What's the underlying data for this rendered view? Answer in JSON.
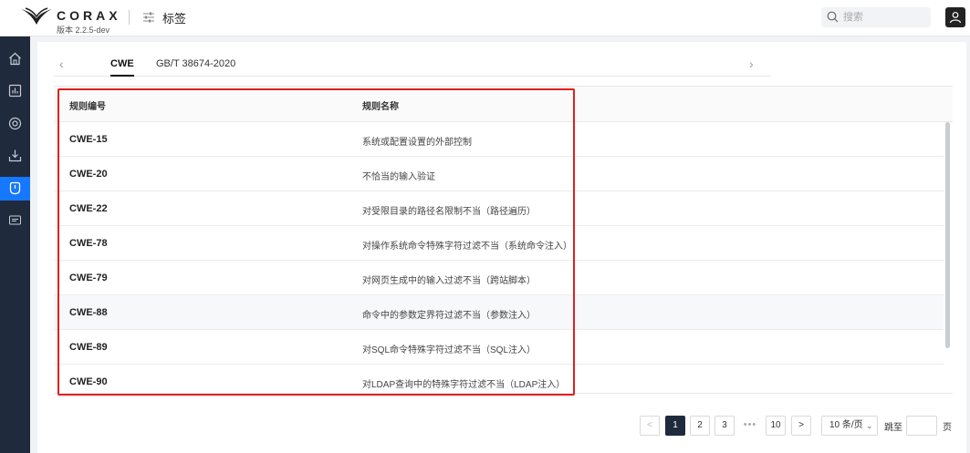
{
  "header": {
    "brand": "CORAX",
    "version": "版本 2.2.5-dev",
    "page_title": "标签",
    "search_placeholder": "搜索"
  },
  "sidebar": {
    "items": [
      {
        "name": "home-icon"
      },
      {
        "name": "chart-icon"
      },
      {
        "name": "target-icon"
      },
      {
        "name": "download-icon"
      },
      {
        "name": "tag-icon",
        "active": true
      },
      {
        "name": "help-icon"
      }
    ]
  },
  "tabs": [
    {
      "label": "CWE",
      "active": true
    },
    {
      "label": "GB/T 38674-2020",
      "active": false
    }
  ],
  "table": {
    "headers": [
      "规则编号",
      "规则名称"
    ],
    "rows": [
      {
        "id": "CWE-15",
        "name": "系统或配置设置的外部控制"
      },
      {
        "id": "CWE-20",
        "name": "不恰当的输入验证"
      },
      {
        "id": "CWE-22",
        "name": "对受限目录的路径名限制不当（路径遍历）"
      },
      {
        "id": "CWE-78",
        "name": "对操作系统命令特殊字符过滤不当（系统命令注入）"
      },
      {
        "id": "CWE-79",
        "name": "对网页生成中的输入过滤不当（跨站脚本）"
      },
      {
        "id": "CWE-88",
        "name": "命令中的参数定界符过滤不当（参数注入）"
      },
      {
        "id": "CWE-89",
        "name": "对SQL命令特殊字符过滤不当（SQL注入）"
      },
      {
        "id": "CWE-90",
        "name": "对LDAP查询中的特殊字符过滤不当（LDAP注入）"
      }
    ]
  },
  "pagination": {
    "prev": "<",
    "pages": [
      "1",
      "2",
      "3"
    ],
    "ellipsis": "•••",
    "last_page": "10",
    "next": ">",
    "page_size": "10 条/页",
    "jump_label": "跳至",
    "jump_unit": "页",
    "current": "1"
  },
  "colors": {
    "sidebar_bg": "#1f2a3c",
    "sidebar_active": "#1677ff",
    "highlight_border": "#e02020"
  }
}
